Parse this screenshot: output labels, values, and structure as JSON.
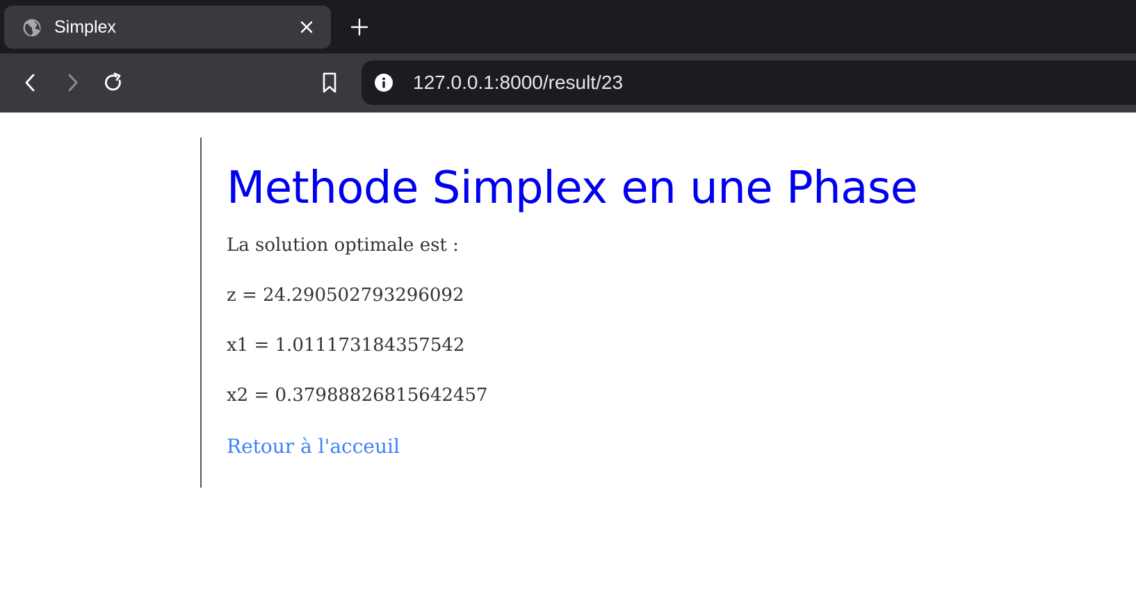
{
  "browser": {
    "tab": {
      "title": "Simplex",
      "favicon": "globe-icon",
      "close_icon": "close-icon"
    },
    "new_tab_icon": "plus-icon",
    "toolbar": {
      "back_icon": "chevron-left-icon",
      "forward_icon": "chevron-right-icon",
      "reload_icon": "reload-icon",
      "bookmark_icon": "bookmark-icon"
    },
    "address_bar": {
      "info_icon": "info-icon",
      "url": "127.0.0.1:8000/result/23"
    }
  },
  "page": {
    "heading": "Methode Simplex en une Phase",
    "intro": "La solution optimale est :",
    "results": [
      "z = 24.290502793296092",
      "x1 = 1.011173184357542",
      "x2 = 0.37988826815642457"
    ],
    "back_link": "Retour à l'acceuil"
  },
  "colors": {
    "tabstrip_bg": "#1c1b20",
    "toolbar_bg": "#3a3a3e",
    "heading": "#0000ee",
    "body_text": "#333333",
    "link": "#3b82f6"
  }
}
